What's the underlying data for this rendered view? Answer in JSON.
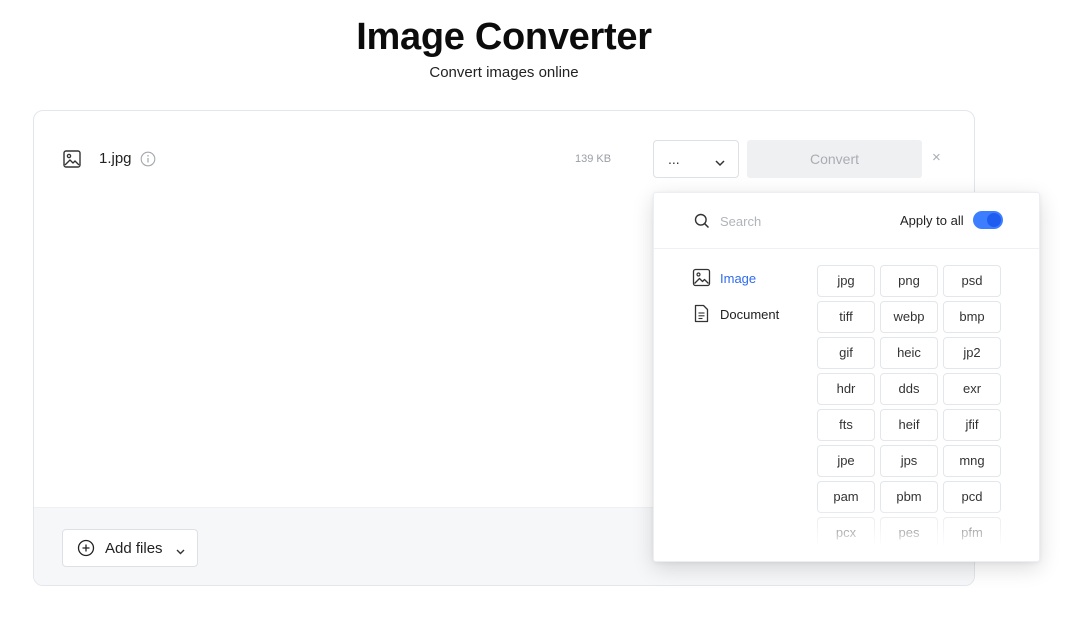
{
  "header": {
    "title": "Image Converter",
    "subtitle": "Convert images online"
  },
  "file": {
    "name": "1.jpg",
    "size": "139 KB",
    "format_value": "...",
    "convert_label": "Convert",
    "remove_label": "×"
  },
  "footer": {
    "add_files_label": "Add files"
  },
  "dropdown": {
    "search_placeholder": "Search",
    "apply_to_all_label": "Apply to all",
    "apply_to_all_on": true,
    "categories": [
      {
        "label": "Image",
        "icon": "image-icon",
        "active": true
      },
      {
        "label": "Document",
        "icon": "document-icon",
        "active": false
      }
    ],
    "formats": [
      "jpg",
      "png",
      "psd",
      "tiff",
      "webp",
      "bmp",
      "gif",
      "heic",
      "jp2",
      "hdr",
      "dds",
      "exr",
      "fts",
      "heif",
      "jfif",
      "jpe",
      "jps",
      "mng",
      "pam",
      "pbm",
      "pcd",
      "pcx",
      "pes",
      "pfm"
    ]
  },
  "colors": {
    "accent": "#2f6bf0",
    "toggle": "#3d7dff"
  }
}
